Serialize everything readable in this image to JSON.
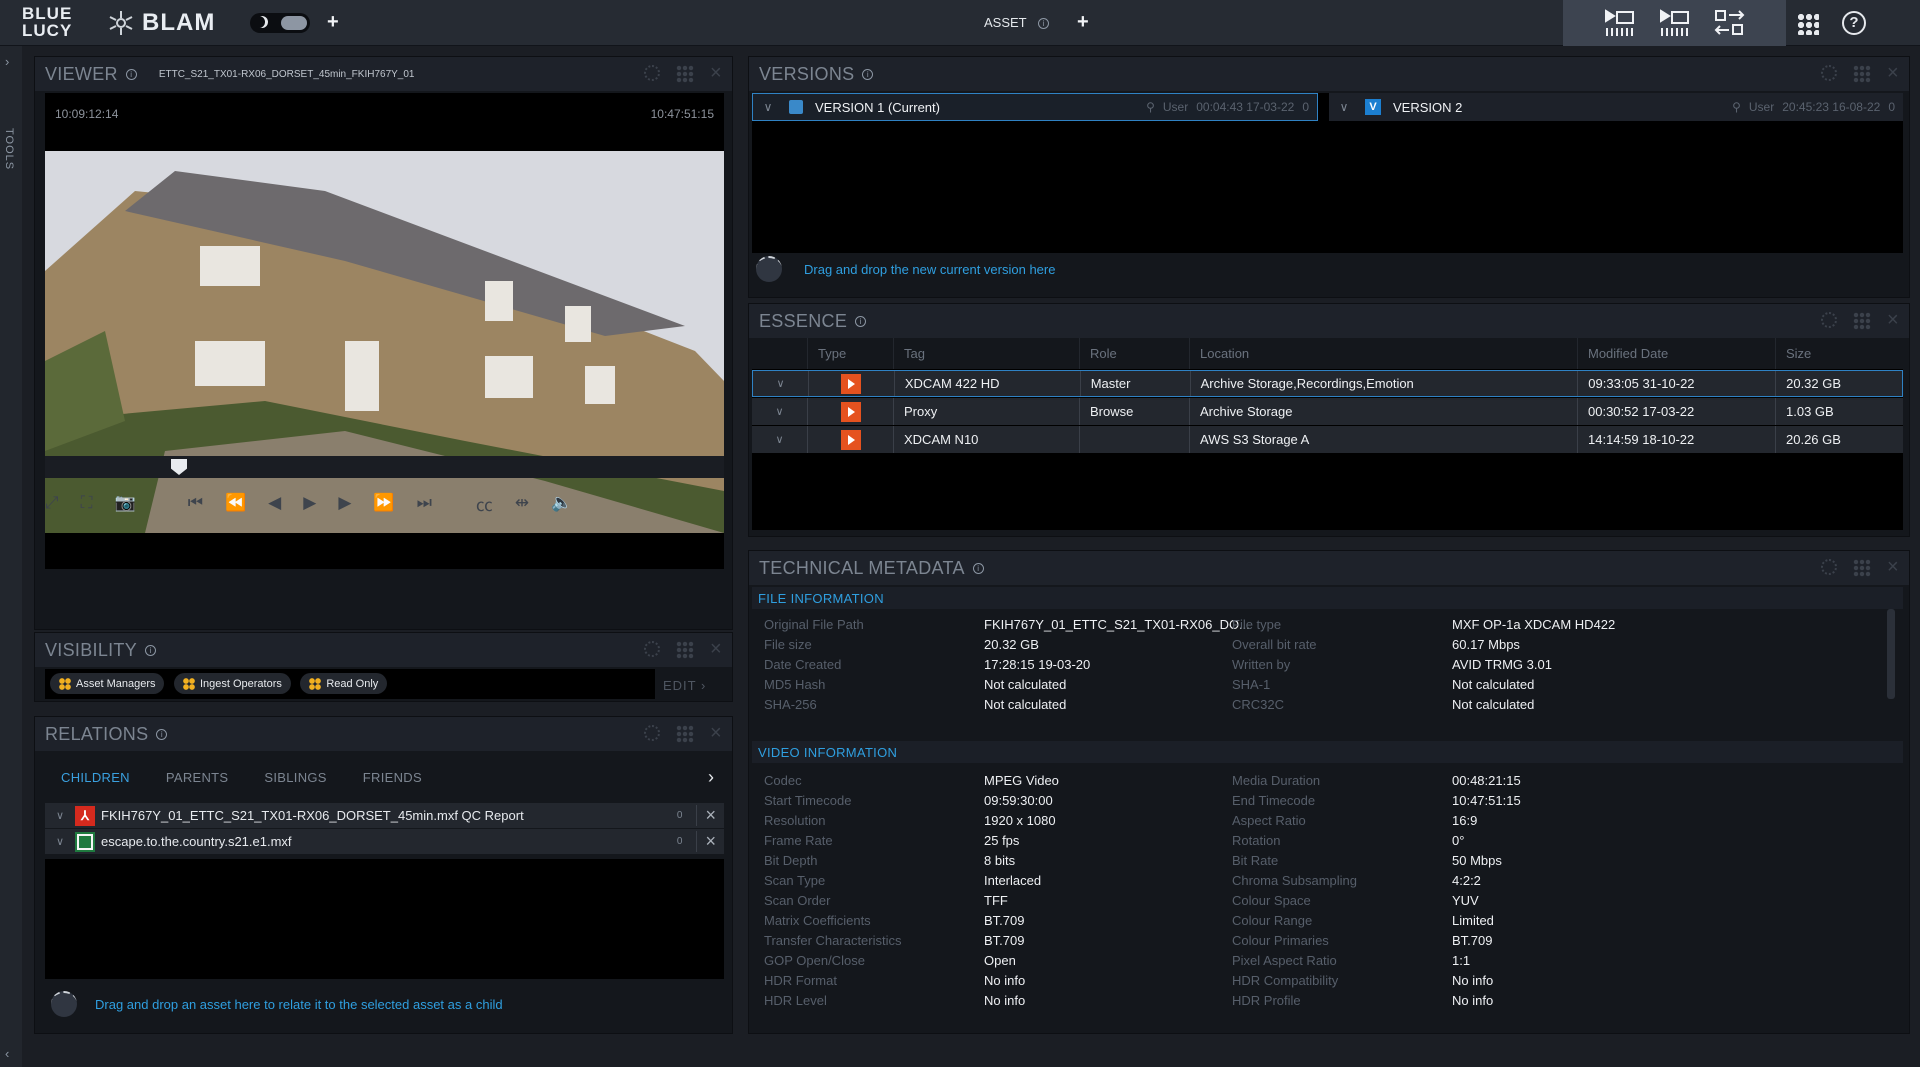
{
  "topbar": {
    "logo_line1": "BLUE",
    "logo_line2": "LUCY",
    "app_name": "BLAM",
    "center_label": "ASSET",
    "colors": {
      "bar": "#262b33",
      "right_block": "#3d4450",
      "accent": "#2f9fe0"
    }
  },
  "tools": {
    "label": "TOOLS"
  },
  "viewer": {
    "title": "VIEWER",
    "filename": "ETTC_S21_TX01-RX06_DORSET_45min_FKIH767Y_01",
    "tc_start": "10:09:12:14",
    "tc_end": "10:47:51:15",
    "scrub_position_fraction": 0.2
  },
  "visibility": {
    "title": "VISIBILITY",
    "tags": [
      "Asset Managers",
      "Ingest Operators",
      "Read Only"
    ],
    "edit_label": "EDIT"
  },
  "relations": {
    "title": "RELATIONS",
    "tabs": [
      "CHILDREN",
      "PARENTS",
      "SIBLINGS",
      "FRIENDS"
    ],
    "active_tab": "CHILDREN",
    "items": [
      {
        "name": "FKIH767Y_01_ETTC_S21_TX01-RX06_DORSET_45min.mxf QC Report",
        "icon": "pdf-icon"
      },
      {
        "name": "escape.to.the.country.s21.e1.mxf",
        "icon": "spreadsheet-icon"
      }
    ],
    "drop_hint": "Drag and drop an asset here to relate it to the selected asset as a child"
  },
  "versions": {
    "title": "VERSIONS",
    "cards": [
      {
        "label": "VERSION 1 (Current)",
        "user": "User",
        "time": "00:04:43 17-03-22",
        "count": "0",
        "selected": true
      },
      {
        "label": "VERSION 2",
        "user": "User",
        "time": "20:45:23 16-08-22",
        "count": "0",
        "selected": false
      }
    ],
    "drop_hint": "Drag and drop the new current version here"
  },
  "essence": {
    "title": "ESSENCE",
    "columns": [
      "Type",
      "Tag",
      "Role",
      "Location",
      "Modified Date",
      "Size"
    ],
    "rows": [
      {
        "tag": "XDCAM 422 HD",
        "role": "Master",
        "location": "Archive Storage,Recordings,Emotion",
        "modified": "09:33:05 31-10-22",
        "size": "20.32 GB"
      },
      {
        "tag": "Proxy",
        "role": "Browse",
        "location": "Archive Storage",
        "modified": "00:30:52 17-03-22",
        "size": "1.03 GB"
      },
      {
        "tag": "XDCAM N10",
        "role": "",
        "location": "AWS S3 Storage A",
        "modified": "14:14:59 18-10-22",
        "size": "20.26 GB"
      }
    ]
  },
  "techmeta": {
    "title": "TECHNICAL METADATA",
    "file_section": "FILE INFORMATION",
    "file_left": [
      {
        "k": "Original File Path",
        "v": "FKIH767Y_01_ETTC_S21_TX01-RX06_DO..."
      },
      {
        "k": "File size",
        "v": "20.32 GB"
      },
      {
        "k": "Date Created",
        "v": "17:28:15 19-03-20"
      },
      {
        "k": "MD5 Hash",
        "v": "Not calculated"
      },
      {
        "k": "SHA-256",
        "v": "Not calculated"
      }
    ],
    "file_right": [
      {
        "k": "File type",
        "v": "MXF OP-1a XDCAM HD422"
      },
      {
        "k": "Overall bit rate",
        "v": "60.17 Mbps"
      },
      {
        "k": "Written by",
        "v": "AVID TRMG 3.01"
      },
      {
        "k": "SHA-1",
        "v": "Not calculated"
      },
      {
        "k": "CRC32C",
        "v": "Not calculated"
      }
    ],
    "video_section": "VIDEO INFORMATION",
    "video_left": [
      {
        "k": "Codec",
        "v": "MPEG Video"
      },
      {
        "k": "Start Timecode",
        "v": "09:59:30:00"
      },
      {
        "k": "Resolution",
        "v": "1920 x 1080"
      },
      {
        "k": "Frame Rate",
        "v": "25 fps"
      },
      {
        "k": "Bit Depth",
        "v": "8 bits"
      },
      {
        "k": "Scan Type",
        "v": "Interlaced"
      },
      {
        "k": "Scan Order",
        "v": "TFF"
      },
      {
        "k": "Matrix Coefficients",
        "v": "BT.709"
      },
      {
        "k": "Transfer Characteristics",
        "v": "BT.709"
      },
      {
        "k": "GOP Open/Close",
        "v": "Open"
      },
      {
        "k": "HDR Format",
        "v": "No info"
      },
      {
        "k": "HDR Level",
        "v": "No info"
      }
    ],
    "video_right": [
      {
        "k": "Media Duration",
        "v": "00:48:21:15"
      },
      {
        "k": "End Timecode",
        "v": "10:47:51:15"
      },
      {
        "k": "Aspect Ratio",
        "v": "16:9"
      },
      {
        "k": "Rotation",
        "v": "0°"
      },
      {
        "k": "Bit Rate",
        "v": "50 Mbps"
      },
      {
        "k": "Chroma Subsampling",
        "v": "4:2:2"
      },
      {
        "k": "Colour Space",
        "v": "YUV"
      },
      {
        "k": "Colour Range",
        "v": "Limited"
      },
      {
        "k": "Colour Primaries",
        "v": "BT.709"
      },
      {
        "k": "Pixel Aspect Ratio",
        "v": "1:1"
      },
      {
        "k": "HDR Compatibility",
        "v": "No info"
      },
      {
        "k": "HDR Profile",
        "v": "No info"
      }
    ]
  }
}
